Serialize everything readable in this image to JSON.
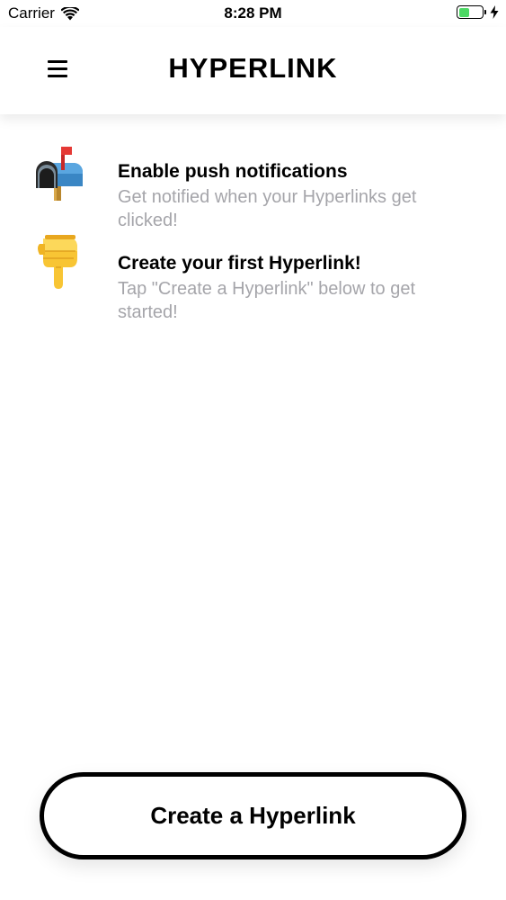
{
  "status_bar": {
    "carrier": "Carrier",
    "time": "8:28 PM",
    "battery_level": 0.45,
    "battery_color": "#4cd964"
  },
  "header": {
    "title": "HYPERLINK",
    "menu_icon": "hamburger-menu-icon"
  },
  "items": [
    {
      "icon": "mailbox-flag-up-icon",
      "title": "Enable push notifications",
      "subtitle": "Get notified when your Hyperlinks get clicked!"
    },
    {
      "icon": "pointing-down-hand-icon",
      "title": "Create your first Hyperlink!",
      "subtitle": "Tap \"Create a Hyperlink\" below to get started!"
    }
  ],
  "cta": {
    "label": "Create a Hyperlink"
  },
  "colors": {
    "subtitle_gray": "#a5a5aa",
    "text": "#000000",
    "background": "#ffffff"
  }
}
